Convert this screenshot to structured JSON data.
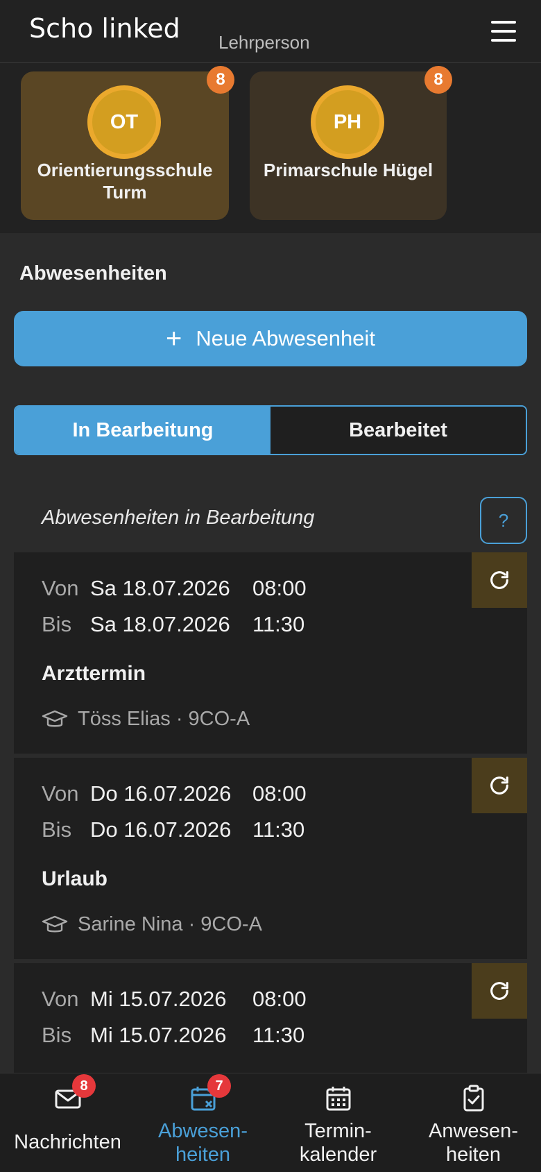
{
  "header": {
    "logo_text": "Scho linked",
    "role": "Lehrperson"
  },
  "schools": [
    {
      "initials": "OT",
      "name": "Orientierungsschule Turm",
      "count": "8"
    },
    {
      "initials": "PH",
      "name": "Primarschule Hügel",
      "count": "8"
    }
  ],
  "main": {
    "title": "Abwesenheiten",
    "new_button": "Neue Abwesenheit",
    "tabs": [
      "In Bearbeitung",
      "Bearbeitet"
    ],
    "list_title": "Abwesenheiten in Bearbeitung",
    "help_label": "?",
    "from_label": "Von",
    "to_label": "Bis"
  },
  "absences": [
    {
      "from_date": "Sa 18.07.2026",
      "from_time": "08:00",
      "to_date": "Sa 18.07.2026",
      "to_time": "11:30",
      "reason": "Arzttermin",
      "student": "Töss Elias · 9CO-A"
    },
    {
      "from_date": "Do 16.07.2026",
      "from_time": "08:00",
      "to_date": "Do 16.07.2026",
      "to_time": "11:30",
      "reason": "Urlaub",
      "student": "Sarine Nina · 9CO-A"
    },
    {
      "from_date": "Mi 15.07.2026",
      "from_time": "08:00",
      "to_date": "Mi 15.07.2026",
      "to_time": "11:30",
      "reason": "",
      "student": ""
    }
  ],
  "nav": [
    {
      "label": "Nachrichten",
      "badge": "8",
      "icon": "envelope-icon"
    },
    {
      "label": "Abwesen-\nheiten",
      "badge": "7",
      "icon": "calendar-x-icon"
    },
    {
      "label": "Termin-\nkalender",
      "badge": "",
      "icon": "calendar-icon"
    },
    {
      "label": "Anwesen-\nheiten",
      "badge": "",
      "icon": "clipboard-check-icon"
    }
  ],
  "colors": {
    "accent": "#4aa0d8",
    "badge_orange": "#e87a30",
    "badge_red": "#e5383b",
    "avatar_gold": "#d39e20"
  }
}
